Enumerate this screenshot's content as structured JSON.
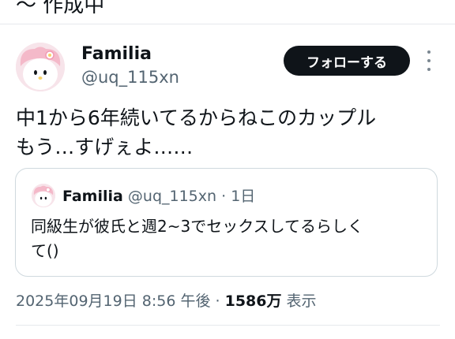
{
  "top_partial_text": "～ 作成中",
  "author": {
    "name": "Familia",
    "handle": "@uq_115xn"
  },
  "follow_button": {
    "label": "フォローする"
  },
  "more_icon": "more-vertical-icon",
  "tweet": {
    "line1": "中1から6年続いてるからねこのカップル",
    "line2": "もう…すげぇよ……"
  },
  "quote": {
    "name": "Familia",
    "handle": "@uq_115xn",
    "separator": "·",
    "time": "1日",
    "line1": "同級生が彼氏と週2~3でセックスしてるらしく",
    "line2": "て()"
  },
  "footer": {
    "timestamp": "2025年09月19日 8:56 午後",
    "separator": "·",
    "views_count": "1586万",
    "views_label": "表示"
  },
  "colors": {
    "text": "#0f1419",
    "secondary": "#536471",
    "follow_bg": "#0f1419",
    "avatar_bg": "#f7e4ea"
  }
}
